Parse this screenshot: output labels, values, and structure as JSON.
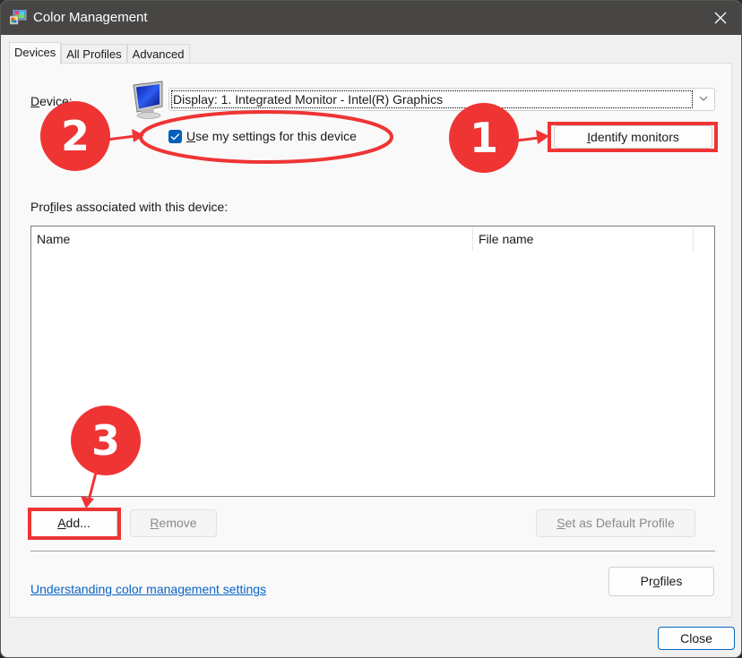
{
  "window": {
    "title": "Color Management",
    "close_glyph": "✕"
  },
  "tabs": [
    {
      "label": "Devices",
      "active": true
    },
    {
      "label": "All Profiles",
      "active": false
    },
    {
      "label": "Advanced",
      "active": false
    }
  ],
  "devices": {
    "device_label_prefix": "D",
    "device_label_rest": "evice:",
    "device_select_value": "Display: 1. Integrated Monitor - Intel(R) Graphics",
    "use_settings_checked": true,
    "use_settings_prefix": "U",
    "use_settings_rest": "se my settings for this device",
    "identify_prefix": "I",
    "identify_rest": "dentify monitors",
    "profiles_label_pre": "Pro",
    "profiles_label_u": "f",
    "profiles_label_rest": "iles associated with this device:",
    "columns": [
      "Name",
      "File name"
    ],
    "rows": [],
    "add_prefix": "A",
    "add_rest": "dd...",
    "remove_prefix": "R",
    "remove_rest": "emove",
    "default_prefix": "S",
    "default_rest": "et as Default Profile",
    "help_link": "Understanding color management settings",
    "profiles_pre": "Pr",
    "profiles_u": "o",
    "profiles_rest": "files"
  },
  "footer": {
    "close_label": "Close"
  },
  "annotations": [
    {
      "number": "1",
      "target": "identify-monitors-button"
    },
    {
      "number": "2",
      "target": "use-my-settings-checkbox"
    },
    {
      "number": "3",
      "target": "add-button"
    }
  ],
  "colors": {
    "annotation_red": "#ef3434",
    "accent_blue": "#005fb8",
    "link_blue": "#0b63c5",
    "titlebar": "#484644"
  }
}
